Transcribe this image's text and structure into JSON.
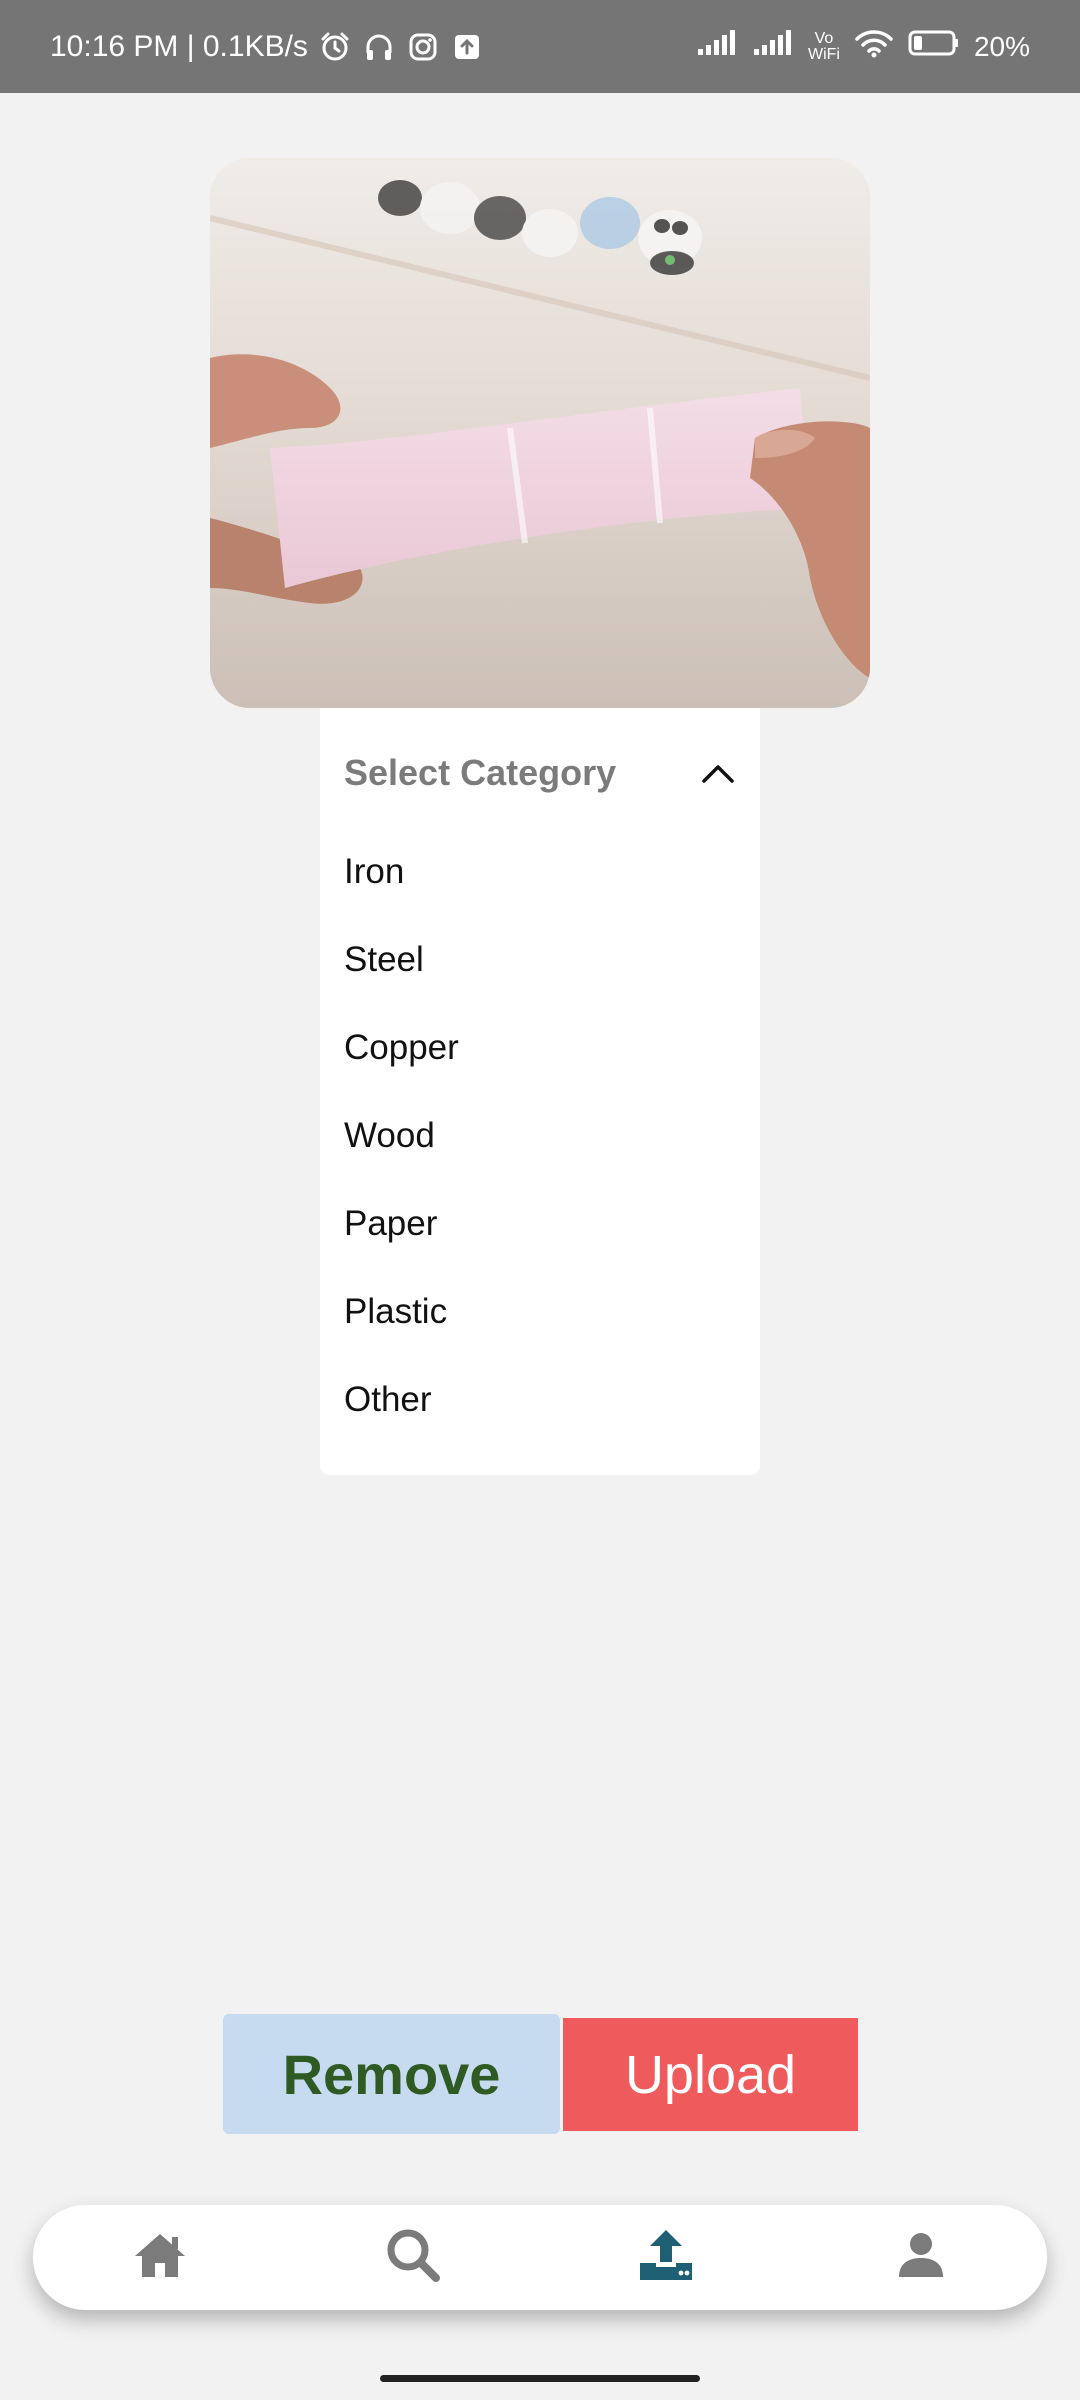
{
  "status": {
    "time_speed": "10:16 PM | 0.1KB/s",
    "vowifi_top": "Vo",
    "vowifi_bottom": "WiFi",
    "battery": "20%"
  },
  "photo": {
    "description_icon": "photo-paper-roll"
  },
  "dropdown": {
    "placeholder": "Select Category",
    "expanded": true,
    "options": [
      "Iron",
      "Steel",
      "Copper",
      "Wood",
      "Paper",
      "Plastic",
      "Other"
    ]
  },
  "actions": {
    "remove_label": "Remove",
    "upload_label": "Upload"
  },
  "nav": {
    "items": [
      {
        "icon": "home-icon",
        "active": false
      },
      {
        "icon": "search-icon",
        "active": false
      },
      {
        "icon": "upload-icon",
        "active": true
      },
      {
        "icon": "profile-icon",
        "active": false
      }
    ]
  },
  "colors": {
    "status_bar": "#757575",
    "background": "#f2f2f2",
    "remove_bg": "#c7dbf0",
    "remove_text": "#2f5a24",
    "upload_bg": "#ef5a5c",
    "nav_active": "#1e5f74",
    "nav_inactive": "#7b7b7b"
  }
}
